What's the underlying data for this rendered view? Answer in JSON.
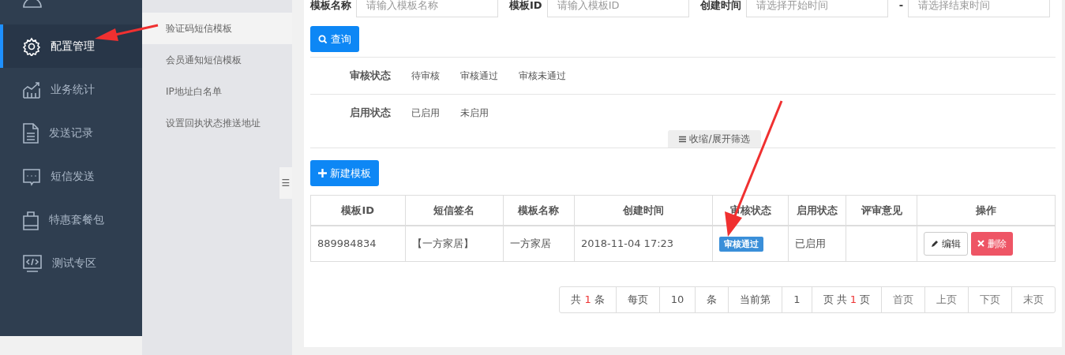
{
  "sidebar": {
    "items": [
      {
        "selected": false
      },
      {
        "label": "配置管理",
        "selected": true
      },
      {
        "label": "业务统计",
        "selected": false
      },
      {
        "label": "发送记录",
        "selected": false
      },
      {
        "label": "短信发送",
        "selected": false
      },
      {
        "label": "特惠套餐包",
        "selected": false
      },
      {
        "label": "测试专区",
        "selected": false
      }
    ]
  },
  "submenu": {
    "items": [
      {
        "label": "验证码短信模板",
        "selected": true
      },
      {
        "label": "会员通知短信模板",
        "selected": false
      },
      {
        "label": "IP地址白名单",
        "selected": false
      },
      {
        "label": "设置回执状态推送地址",
        "selected": false
      }
    ],
    "collapse_handle": "☰"
  },
  "search_form": {
    "fields": [
      {
        "label": "模板名称",
        "placeholder": "请输入模板名称"
      },
      {
        "label": "模板ID",
        "placeholder": "请输入模板ID"
      },
      {
        "label": "创建时间",
        "placeholder": "请选择开始时间"
      },
      {
        "label": "-",
        "placeholder": "请选择结束时间"
      }
    ],
    "search_button": "查询"
  },
  "filters": [
    {
      "label": "审核状态",
      "options": [
        "待审核",
        "审核通过",
        "审核未通过"
      ]
    },
    {
      "label": "启用状态",
      "options": [
        "已启用",
        "未启用"
      ]
    }
  ],
  "filter_toggle": "收缩/展开筛选",
  "new_button": "新建模板",
  "table": {
    "columns": [
      "模板ID",
      "短信签名",
      "模板名称",
      "创建时间",
      "审核状态",
      "启用状态",
      "评审意见",
      "操作"
    ],
    "rows": [
      {
        "id": "889984834",
        "signature": "【一方家居】",
        "name": "一方家居",
        "created": "2018-11-04 17:23",
        "review_status": "审核通过",
        "enabled": "已启用",
        "actions": [
          "编辑",
          "删除"
        ]
      }
    ]
  },
  "pagination": [
    {
      "kind": "count",
      "parts": [
        "共",
        "1",
        "条"
      ]
    },
    {
      "kind": "text",
      "parts": [
        "每页"
      ]
    },
    {
      "kind": "text",
      "parts": [
        "10"
      ]
    },
    {
      "kind": "text",
      "parts": [
        "条"
      ]
    },
    {
      "kind": "text",
      "parts": [
        "当前第"
      ]
    },
    {
      "kind": "text",
      "parts": [
        "1"
      ]
    },
    {
      "kind": "count",
      "parts": [
        "页 共",
        "1",
        "页"
      ]
    },
    {
      "kind": "link",
      "parts": [
        "首页"
      ]
    },
    {
      "kind": "link",
      "parts": [
        "上页"
      ]
    },
    {
      "kind": "link",
      "parts": [
        "下页"
      ]
    },
    {
      "kind": "link",
      "parts": [
        "末页"
      ]
    }
  ]
}
